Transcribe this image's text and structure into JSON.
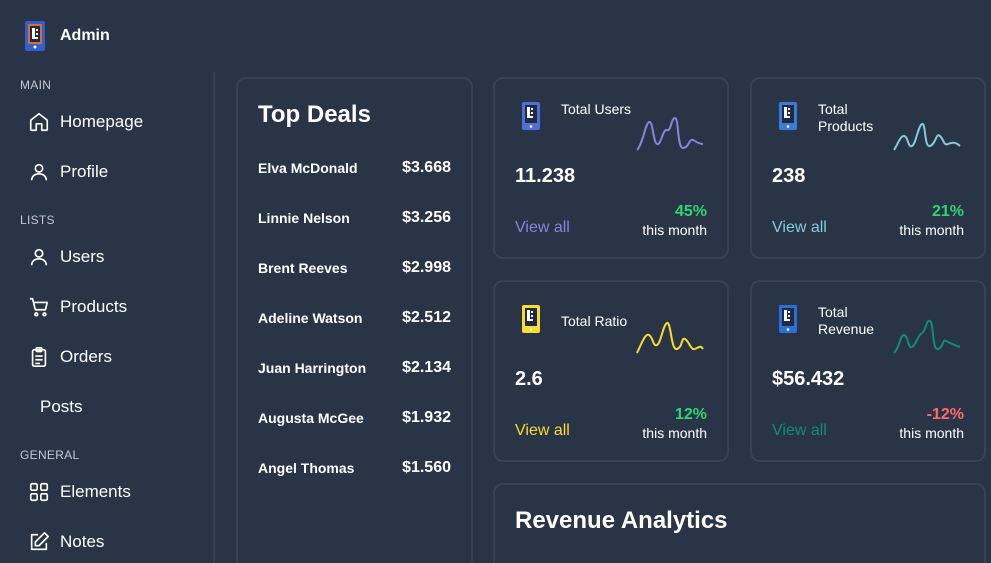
{
  "brand": {
    "name": "Admin"
  },
  "sidebar": {
    "sections": [
      {
        "title": "MAIN",
        "items": [
          {
            "label": "Homepage",
            "icon": "home-icon"
          },
          {
            "label": "Profile",
            "icon": "user-icon"
          }
        ]
      },
      {
        "title": "LISTS",
        "items": [
          {
            "label": "Users",
            "icon": "user-icon"
          },
          {
            "label": "Products",
            "icon": "cart-icon"
          },
          {
            "label": "Orders",
            "icon": "clipboard-icon"
          },
          {
            "label": "Posts",
            "icon": ""
          }
        ]
      },
      {
        "title": "GENERAL",
        "items": [
          {
            "label": "Elements",
            "icon": "grid-icon"
          },
          {
            "label": "Notes",
            "icon": "edit-icon"
          }
        ]
      }
    ]
  },
  "deals": {
    "title": "Top Deals",
    "rows": [
      {
        "name": "Elva McDonald",
        "amount": "$3.668"
      },
      {
        "name": "Linnie Nelson",
        "amount": "$3.256"
      },
      {
        "name": "Brent Reeves",
        "amount": "$2.998"
      },
      {
        "name": "Adeline Watson",
        "amount": "$2.512"
      },
      {
        "name": "Juan Harrington",
        "amount": "$2.134"
      },
      {
        "name": "Augusta McGee",
        "amount": "$1.932"
      },
      {
        "name": "Angel Thomas",
        "amount": "$1.560"
      }
    ]
  },
  "stats": [
    {
      "title": "Total Users",
      "value": "11.238",
      "link": "View all",
      "percent": "45%",
      "period": "this month",
      "color": "#8884d8",
      "pct_color": "#2ed573",
      "icon": "users-box-icon",
      "icon_color": "#4f6fd6"
    },
    {
      "title": "Total Products",
      "value": "238",
      "link": "View all",
      "percent": "21%",
      "period": "this month",
      "color": "#82ccdd",
      "pct_color": "#2ed573",
      "icon": "products-box-icon",
      "icon_color": "#3a7bd5"
    },
    {
      "title": "Total Ratio",
      "value": "2.6",
      "link": "View all",
      "percent": "12%",
      "period": "this month",
      "color": "#f8dc2e",
      "pct_color": "#2ed573",
      "icon": "ratio-box-icon",
      "icon_color": "#f8dc2e"
    },
    {
      "title": "Total Revenue",
      "value": "$56.432",
      "link": "View all",
      "percent": "-12%",
      "period": "this month",
      "color": "#0f8c7d",
      "pct_color": "#ff6b6b",
      "icon": "revenue-box-icon",
      "icon_color": "#2a6fd6"
    }
  ],
  "revenue": {
    "title": "Revenue Analytics"
  }
}
